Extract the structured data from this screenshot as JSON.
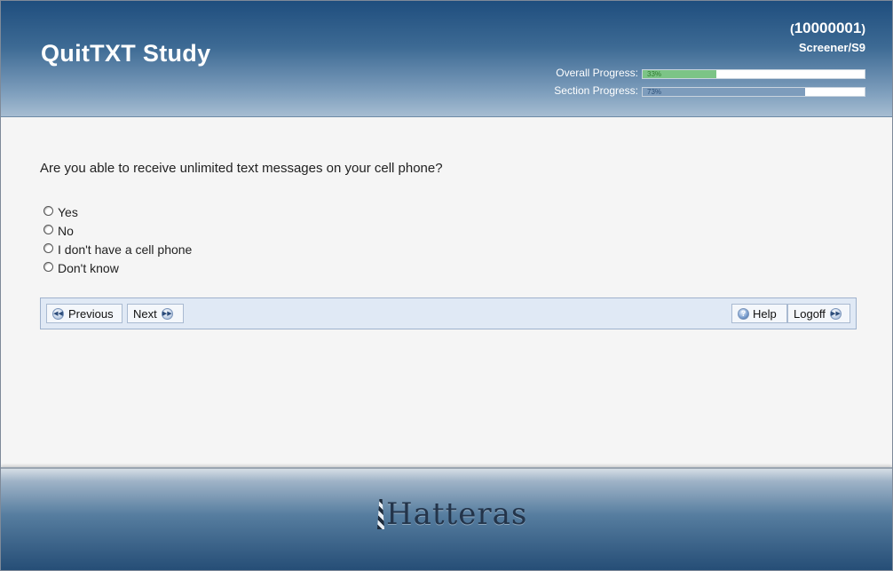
{
  "header": {
    "title": "QuitTXT Study",
    "case_id": "10000001",
    "section_code": "Screener/S9",
    "overall_label": "Overall Progress:",
    "overall_pct_text": "33%",
    "overall_fraction": 0.33,
    "section_label": "Section Progress:",
    "section_pct_text": "73%",
    "section_fraction": 0.73
  },
  "question": {
    "text": "Are you able to receive unlimited text messages on your cell phone?",
    "options": [
      "Yes",
      "No",
      "I don't have a cell phone",
      "Don't know"
    ]
  },
  "nav": {
    "previous": "Previous",
    "next": "Next",
    "help": "Help",
    "logoff": "Logoff"
  },
  "footer": {
    "logo_text": "Hatteras"
  },
  "colors": {
    "header_dark": "#1f4e7e",
    "progress_green": "#7cc486",
    "progress_blue": "#7d9cbc"
  }
}
